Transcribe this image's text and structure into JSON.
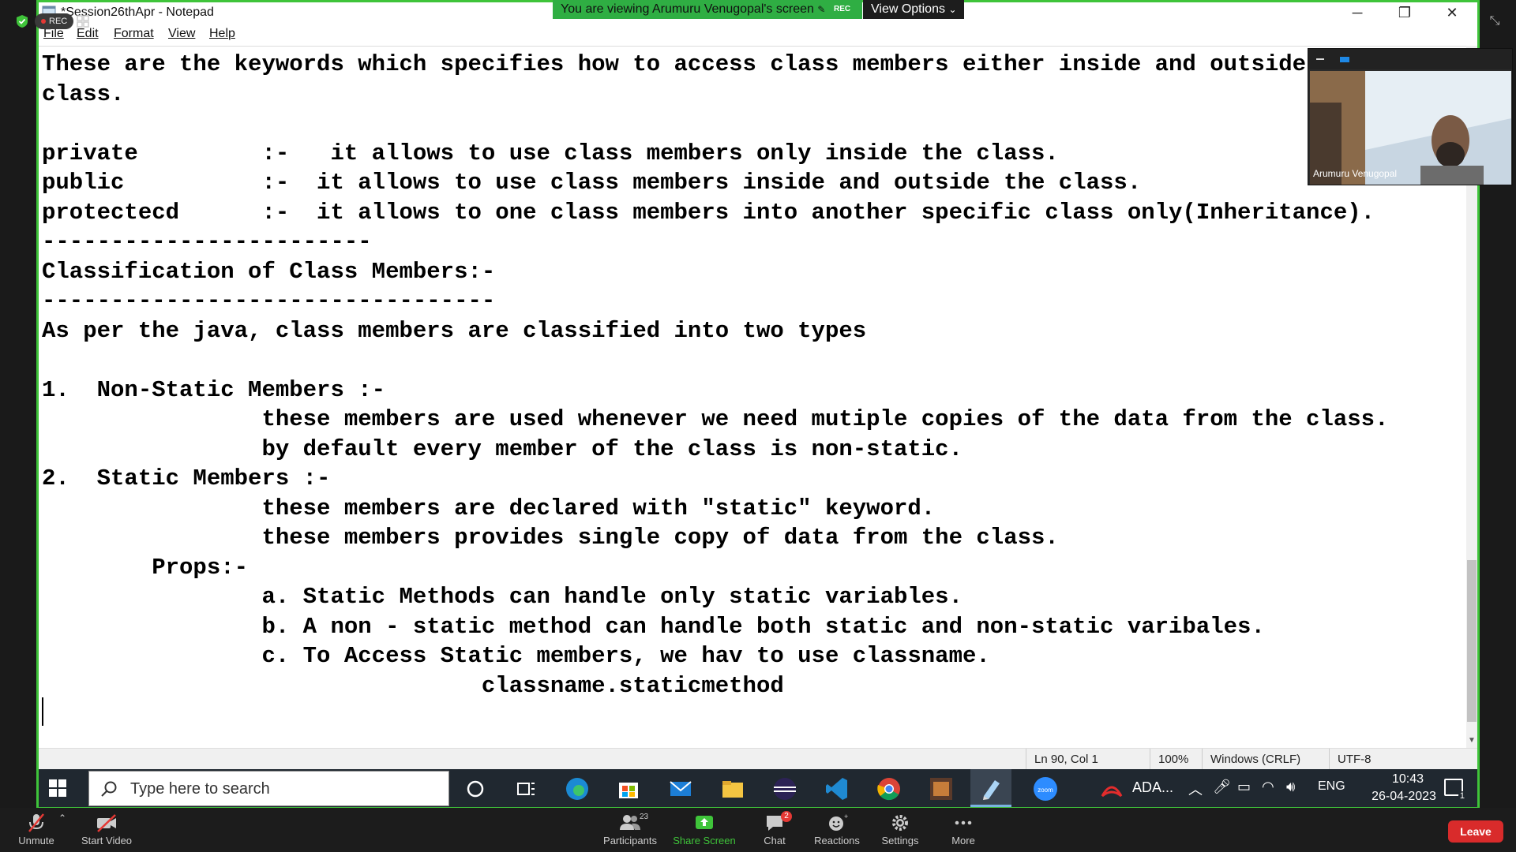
{
  "zoom": {
    "rec_label": "REC",
    "banner_text": "You are viewing Arumuru Venugopal's screen",
    "banner_rec": "REC",
    "view_options": "View Options",
    "participant_name": "Arumuru Venugopal",
    "toolbar": {
      "unmute": "Unmute",
      "start_video": "Start Video",
      "participants": "Participants",
      "participants_count": "23",
      "share_screen": "Share Screen",
      "chat": "Chat",
      "chat_count": "2",
      "reactions": "Reactions",
      "settings": "Settings",
      "more": "More",
      "leave": "Leave"
    }
  },
  "notepad": {
    "title": "*Session26thApr - Notepad",
    "menu": [
      "File",
      "Edit",
      "Format",
      "View",
      "Help"
    ],
    "lines": [
      "These are the keywords which specifies how to access class members either inside and outside the",
      "class.",
      "",
      "private         :-   it allows to use class members only inside the class.",
      "public          :-  it allows to use class members inside and outside the class.",
      "protectecd      :-  it allows to one class members into another specific class only(Inheritance).",
      "------------------------",
      "Classification of Class Members:-",
      "---------------------------------",
      "As per the java, class members are classified into two types",
      "",
      "1.  Non-Static Members :-",
      "                these members are used whenever we need mutiple copies of the data from the class.",
      "                by default every member of the class is non-static.",
      "2.  Static Members :-",
      "                these members are declared with \"static\" keyword.",
      "                these members provides single copy of data from the class.",
      "        Props:-",
      "                a. Static Methods can handle only static variables.",
      "                b. A non - static method can handle both static and non-static varibales.",
      "                c. To Access Static members, we hav to use classname.",
      "                                classname.staticmethod",
      ""
    ],
    "status": {
      "position": "Ln 90, Col 1",
      "zoom": "100%",
      "line_ending": "Windows (CRLF)",
      "encoding": "UTF-8"
    }
  },
  "taskbar": {
    "search_placeholder": "Type here to search",
    "app_label": "ADA...",
    "language": "ENG",
    "time": "10:43",
    "date": "26-04-2023",
    "notification_count": "1"
  }
}
